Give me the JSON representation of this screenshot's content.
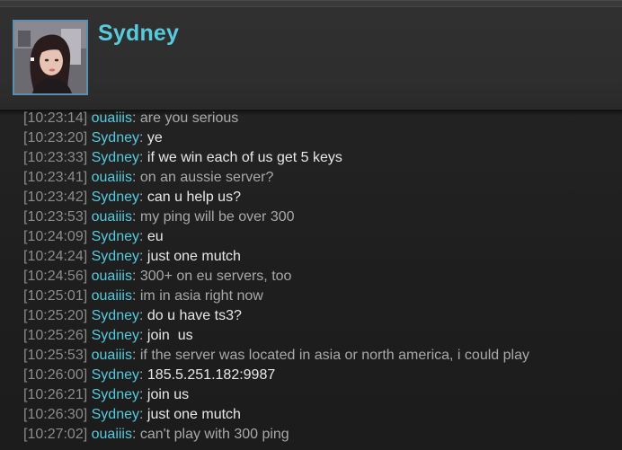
{
  "header": {
    "username": "Sydney"
  },
  "colors": {
    "name_color": "#57cbde",
    "timestamp_color": "#8c8c8c",
    "self_text_color": "#e8e8e8",
    "other_text_color": "#a9a9a9",
    "background": "#1b1b1b"
  },
  "messages": [
    {
      "time": "[10:23:14]",
      "sender": "ouaiiis",
      "text": "are you serious"
    },
    {
      "time": "[10:23:20]",
      "sender": "Sydney",
      "text": "ye"
    },
    {
      "time": "[10:23:33]",
      "sender": "Sydney",
      "text": "if we win each of us get 5 keys"
    },
    {
      "time": "[10:23:41]",
      "sender": "ouaiiis",
      "text": "on an aussie server?"
    },
    {
      "time": "[10:23:42]",
      "sender": "Sydney",
      "text": "can u help us?"
    },
    {
      "time": "[10:23:53]",
      "sender": "ouaiiis",
      "text": "my ping will be over 300"
    },
    {
      "time": "[10:24:09]",
      "sender": "Sydney",
      "text": "eu"
    },
    {
      "time": "[10:24:24]",
      "sender": "Sydney",
      "text": "just one mutch"
    },
    {
      "time": "[10:24:56]",
      "sender": "ouaiiis",
      "text": "300+ on eu servers, too"
    },
    {
      "time": "[10:25:01]",
      "sender": "ouaiiis",
      "text": "im in asia right now"
    },
    {
      "time": "[10:25:20]",
      "sender": "Sydney",
      "text": "do u have ts3?"
    },
    {
      "time": "[10:25:26]",
      "sender": "Sydney",
      "text": "join  us"
    },
    {
      "time": "[10:25:53]",
      "sender": "ouaiiis",
      "text": "if the server was located in asia or north america, i could play"
    },
    {
      "time": "[10:26:00]",
      "sender": "Sydney",
      "text": "185.5.251.182:9987"
    },
    {
      "time": "[10:26:21]",
      "sender": "Sydney",
      "text": "join us"
    },
    {
      "time": "[10:26:30]",
      "sender": "Sydney",
      "text": "just one mutch"
    },
    {
      "time": "[10:27:02]",
      "sender": "ouaiiis",
      "text": "can't play with 300 ping"
    }
  ]
}
